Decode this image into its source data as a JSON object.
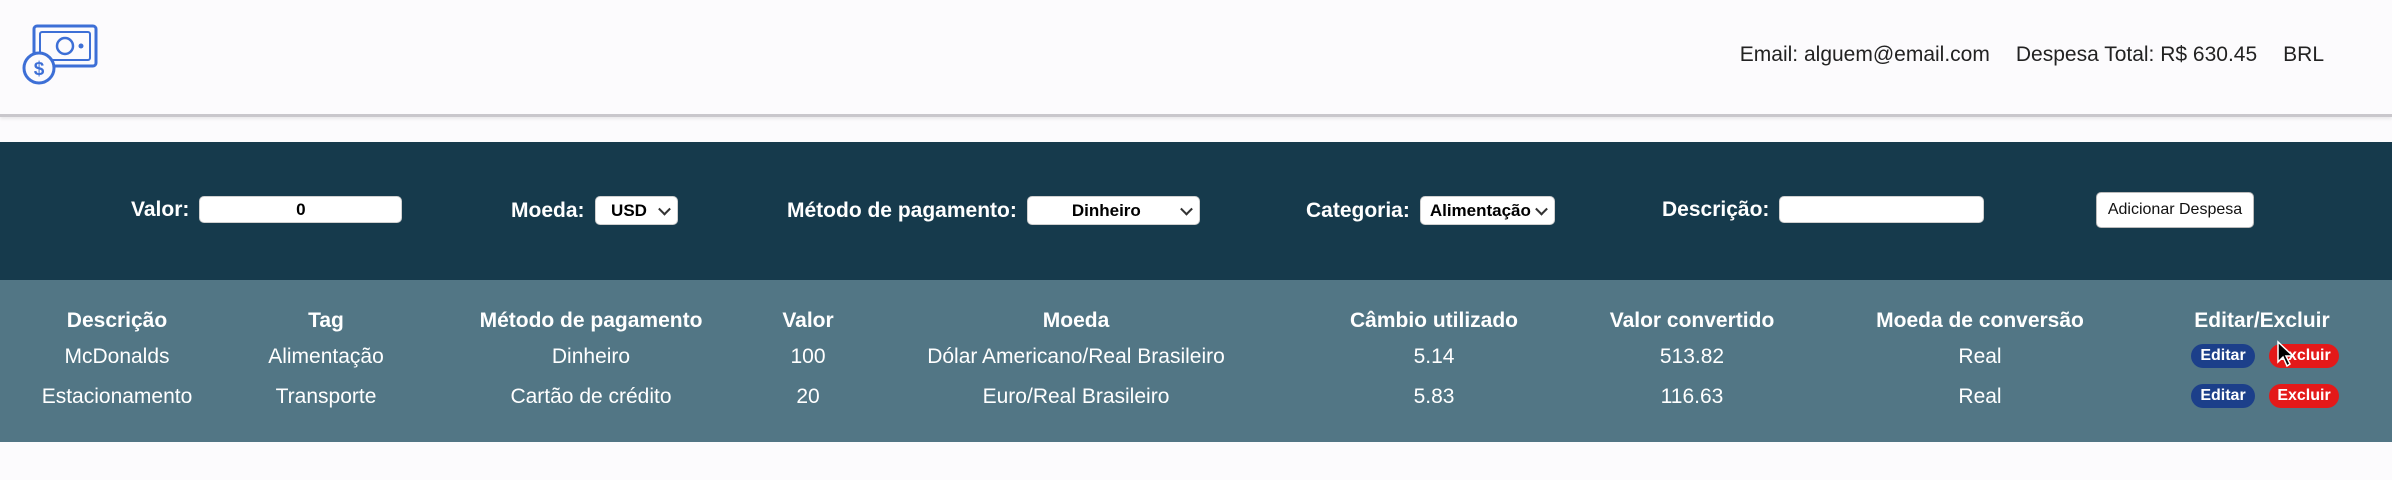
{
  "header": {
    "logo_icon": "money-bill-dollar-icon",
    "email": "Email: alguem@email.com",
    "total": "Despesa Total: R$ 630.45",
    "currency": "BRL"
  },
  "form": {
    "valor_label": "Valor:",
    "valor_value": "0",
    "moeda_label": "Moeda:",
    "moeda_value": "USD",
    "metodo_label": "Método de pagamento:",
    "metodo_value": "Dinheiro",
    "categoria_label": "Categoria:",
    "categoria_value": "Alimentação",
    "descricao_label": "Descrição:",
    "descricao_value": "",
    "add_button": "Adicionar Despesa"
  },
  "table": {
    "headers": [
      "Descrição",
      "Tag",
      "Método de pagamento",
      "Valor",
      "Moeda",
      "Câmbio utilizado",
      "Valor convertido",
      "Moeda de conversão",
      "Editar/Excluir"
    ],
    "rows": [
      {
        "descricao": "McDonalds",
        "tag": "Alimentação",
        "metodo": "Dinheiro",
        "valor": "100",
        "moeda": "Dólar Americano/Real Brasileiro",
        "cambio": "5.14",
        "convertido": "513.82",
        "conversao": "Real",
        "edit": "Editar",
        "delete": "Excluir"
      },
      {
        "descricao": "Estacionamento",
        "tag": "Transporte",
        "metodo": "Cartão de crédito",
        "valor": "20",
        "moeda": "Euro/Real Brasileiro",
        "cambio": "5.83",
        "convertido": "116.63",
        "conversao": "Real",
        "edit": "Editar",
        "delete": "Excluir"
      }
    ]
  },
  "colors": {
    "form_bg": "#163a4c",
    "table_bg": "#527685",
    "edit_btn": "#1c3f8a",
    "delete_btn": "#e41919",
    "logo": "#3d6fd6"
  }
}
